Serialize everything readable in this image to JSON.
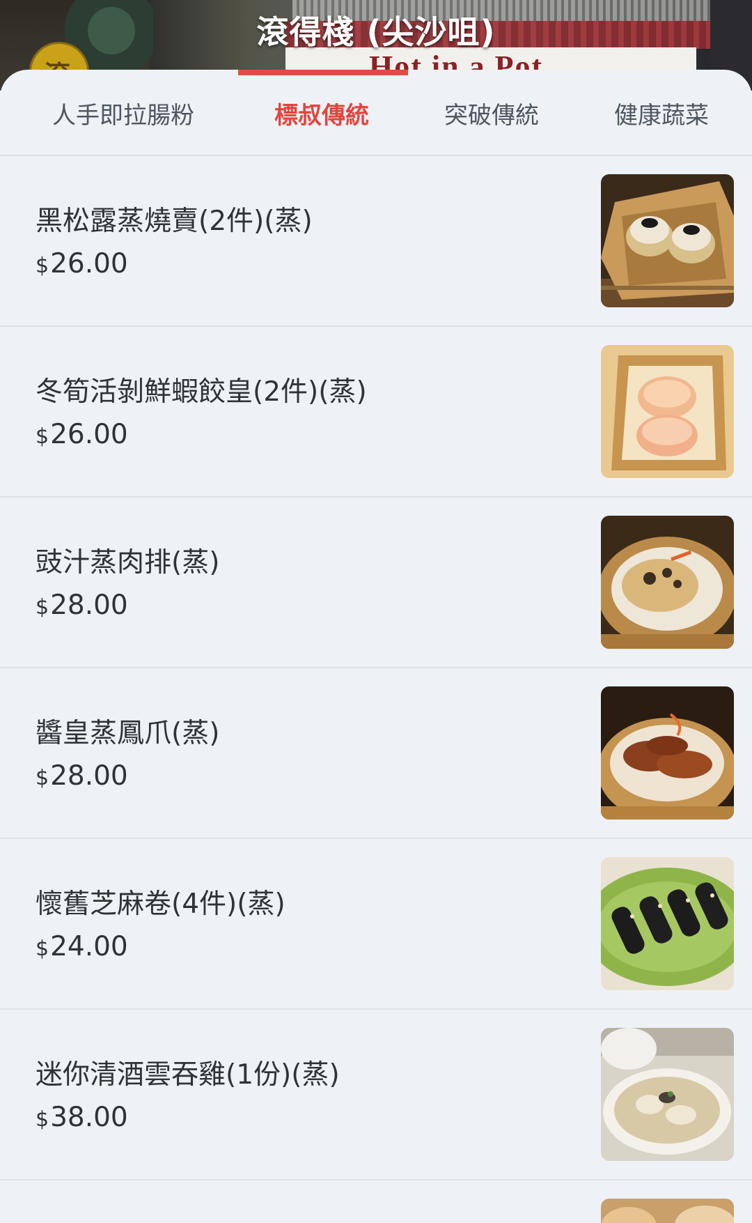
{
  "header": {
    "store_name": "滾得棧 (尖沙咀)",
    "sign_text": "Hot in a Pot",
    "logo_glyph": "滾"
  },
  "tabs": [
    {
      "label": "人手即拉腸粉",
      "active": false
    },
    {
      "label": "標叔傳統",
      "active": true
    },
    {
      "label": "突破傳統",
      "active": false
    },
    {
      "label": "健康蔬菜",
      "active": false
    }
  ],
  "menu": {
    "currency_symbol": "$",
    "items": [
      {
        "name": "黑松露蒸燒賣(2件)(蒸)",
        "price": "26.00",
        "image": "siu-mai-truffle-photo"
      },
      {
        "name": "冬筍活剝鮮蝦餃皇(2件)(蒸)",
        "price": "26.00",
        "image": "har-gow-photo"
      },
      {
        "name": "豉汁蒸肉排(蒸)",
        "price": "28.00",
        "image": "spare-ribs-photo"
      },
      {
        "name": "醬皇蒸鳳爪(蒸)",
        "price": "28.00",
        "image": "chicken-feet-photo"
      },
      {
        "name": "懷舊芝麻卷(4件)(蒸)",
        "price": "24.00",
        "image": "sesame-roll-photo"
      },
      {
        "name": "迷你清酒雲吞雞(1份)(蒸)",
        "price": "38.00",
        "image": "wonton-chicken-photo"
      }
    ]
  },
  "colors": {
    "accent": "#e34a44",
    "background": "#eef2f6",
    "text": "#2f3338",
    "tab_text": "#4e5660"
  }
}
